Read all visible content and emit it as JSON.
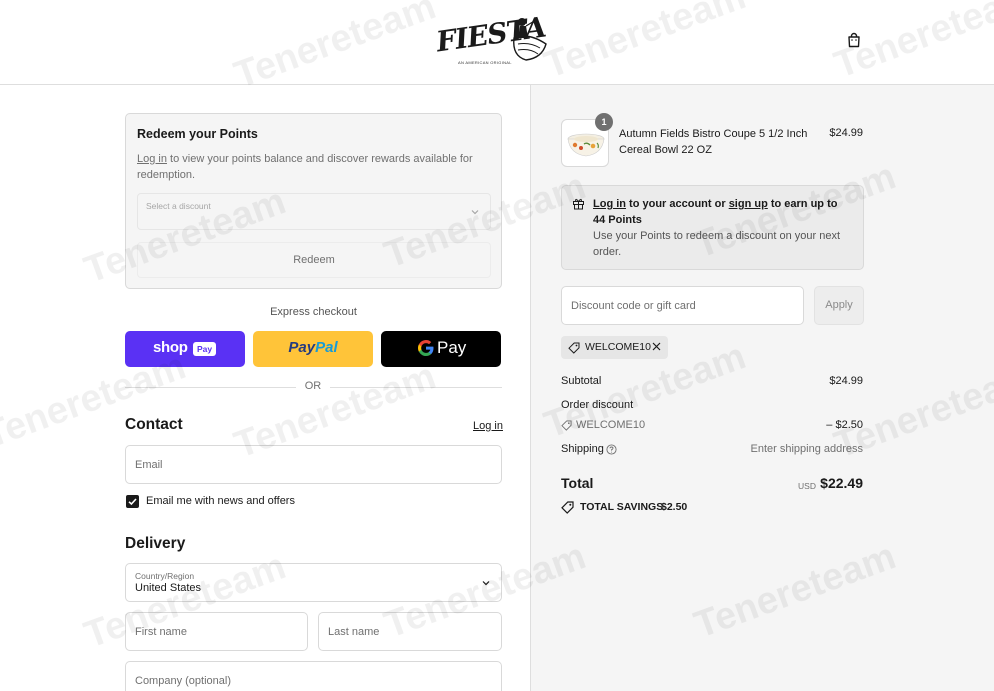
{
  "header": {
    "logo_text": "FIESTA",
    "logo_tagline": "AN AMERICAN ORIGINAL",
    "bag_icon": "shopping-bag-icon"
  },
  "redeem": {
    "title": "Redeem your Points",
    "login_link": "Log in",
    "description": " to view your points balance and discover rewards available for redemption.",
    "select_placeholder": "Select a discount",
    "button_label": "Redeem"
  },
  "express": {
    "label": "Express checkout",
    "shop_label": "shop",
    "shop_pay_badge": "Pay",
    "paypal_pay": "Pay",
    "paypal_pal": "Pal",
    "gpay_label": "Pay",
    "or_label": "OR"
  },
  "contact": {
    "title": "Contact",
    "login_label": "Log in",
    "email_placeholder": "Email",
    "newsletter_label": "Email me with news and offers",
    "newsletter_checked": true
  },
  "delivery": {
    "title": "Delivery",
    "country_label": "Country/Region",
    "country_value": "United States",
    "first_name_placeholder": "First name",
    "last_name_placeholder": "Last name",
    "company_placeholder": "Company (optional)"
  },
  "summary": {
    "product": {
      "quantity": "1",
      "name": "Autumn Fields Bistro Coupe 5 1/2 Inch Cereal Bowl 22 OZ",
      "price": "$24.99"
    },
    "points_banner": {
      "login_link": "Log in",
      "middle": " to your account or ",
      "signup_link": "sign up",
      "after": " to earn up to 44 Points",
      "subtext": "Use your Points to redeem a discount on your next order."
    },
    "discount_placeholder": "Discount code or gift card",
    "apply_label": "Apply",
    "applied_code": "WELCOME10",
    "subtotal_label": "Subtotal",
    "subtotal_value": "$24.99",
    "order_discount_label": "Order discount",
    "discount_code_label": "WELCOME10",
    "discount_value": "– $2.50",
    "shipping_label": "Shipping",
    "shipping_value": "Enter shipping address",
    "total_label": "Total",
    "total_currency": "USD",
    "total_value": "$22.49",
    "savings_label": "TOTAL SAVINGS",
    "savings_value": "$2.50"
  },
  "watermark": "Tenereteam",
  "colors": {
    "shop_pay": "#5a31f4",
    "paypal": "#ffc439",
    "gpay": "#000000",
    "summary_bg": "#f5f5f5"
  }
}
